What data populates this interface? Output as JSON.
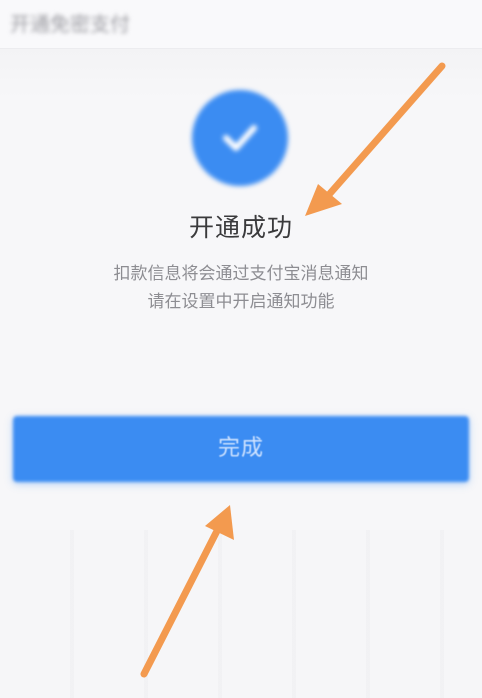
{
  "header": {
    "title": "开通免密支付"
  },
  "status": {
    "icon": "check-circle-icon",
    "title": "开通成功",
    "description_line1": "扣款信息将会通过支付宝消息通知",
    "description_line2": "请在设置中开启通知功能"
  },
  "actions": {
    "done_label": "完成"
  },
  "colors": {
    "primary": "#3b8cf2",
    "annotation_arrow": "#f39a4f",
    "title_text": "#3a3a3c",
    "secondary_text": "#8d8d92"
  }
}
